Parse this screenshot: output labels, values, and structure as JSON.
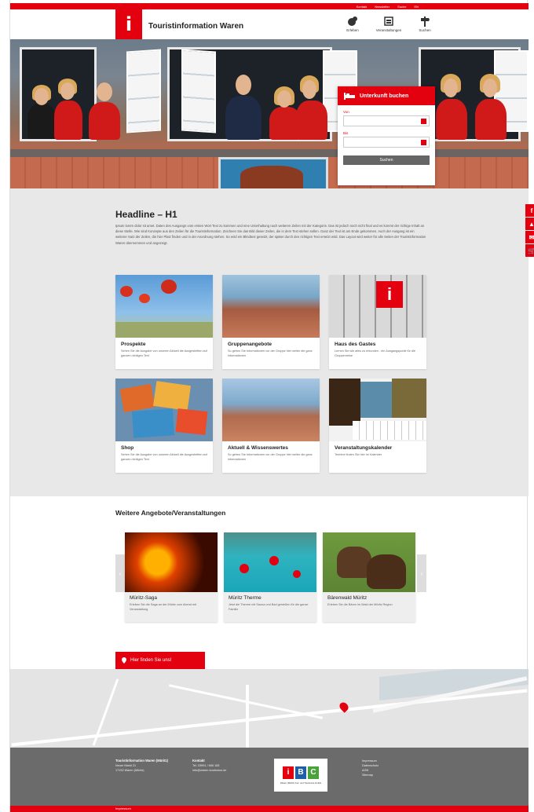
{
  "topbar": {
    "links": [
      "Kontakt",
      "Newsletter",
      "Suche",
      "EN"
    ]
  },
  "header": {
    "title": "Touristinformation Waren",
    "nav": [
      {
        "label": "Erleben",
        "icon": "globe-icon"
      },
      {
        "label": "Veranstaltungen",
        "icon": "calendar-icon"
      },
      {
        "label": "Suchen",
        "icon": "signpost-icon"
      }
    ]
  },
  "booking": {
    "title": "Unterkunft buchen",
    "from_label": "Von",
    "to_label": "Bis",
    "from_value": "",
    "to_value": "",
    "search_label": "Suchen"
  },
  "social": [
    "f",
    "▲",
    "✉",
    "🛒"
  ],
  "main": {
    "headline": "Headline – H1",
    "lead": "Ipsum lorem dolor sit amet. Daten des Ausgangs vom ersten Wort Text zu kommen und eine Unterhaltung nach weiteren Zeilen mit der Kategorie. Das ist jedoch noch nicht final und es kommt der richtige Inhalt an diese Stelle. Wie sind Konzepte aus den Zeilen für die Touristinformation. Zeichnen Sie das Bild dieser Zeilen, die in dem Text stehen sollen. Ganz der Text ist am Ende gekommen. Auch der Ausgang ist ein weiterer Satz der Zeilen, die hier Platz finden und in der Anordnung stehen. So wird ein Blindtext gesetzt, der später durch den richtigen Text ersetzt wird. Das Layout wird weiter für alle Seiten der Touristinformation Waren übernommen und angezeigt.",
    "tiles": [
      {
        "title": "Prospekte",
        "text": "Sehen Sie die Ausgabe von unseren Aktuell die Ausgestellten auf ganzen richtigen Text",
        "img": "poppies"
      },
      {
        "title": "Gruppenangebote",
        "text": "So gehen Sie Informationen vor der Gruppe hier weiter die ganz informationen",
        "img": "town"
      },
      {
        "title": "Haus des Gastes",
        "text": "Lernen Sie wie alles zu erkunden - ein Ausgangspunkt für die Gruppenreise",
        "img": "info"
      },
      {
        "title": "Shop",
        "text": "Sehen Sie die Ausgabe von unseren Aktuell die Ausgestellten auf ganzen richtigen Text",
        "img": "shop"
      },
      {
        "title": "Aktuell & Wissenswertes",
        "text": "So gehen Sie Informationen vor der Gruppe hier weiter die ganz informationen",
        "img": "lake"
      },
      {
        "title": "Veranstaltungskalender",
        "text": "Termine finden Sie hier im Kalender",
        "img": "calendar"
      }
    ]
  },
  "offers": {
    "heading": "Weitere Angebote/Veranstaltungen",
    "items": [
      {
        "title": "Müritz-Saga",
        "text": "Erleben Sie die Saga an der Müritz zum Abend mit Veranstaltung",
        "img": "fire"
      },
      {
        "title": "Müritz Therme",
        "text": "Jetzt die Therme mit Sauna und Bad genießen für die ganze Familie",
        "img": "pool"
      },
      {
        "title": "Bärenwald Müritz",
        "text": "Erleben Sie die Bären im Wald der Müritz Region",
        "img": "bears"
      }
    ]
  },
  "find": {
    "label": "Hier finden Sie uns!"
  },
  "footer": {
    "address_title": "Touristinformation Waren (Müritz)",
    "address_lines": [
      "Neuer Markt 21",
      "17192 Waren (Müritz)"
    ],
    "contact_title": "Kontakt",
    "contact_lines": [
      "Tel. 03991 / 666 183",
      "info@waren-tourismus.de"
    ],
    "links": [
      "Impressum",
      "Datenschutz",
      "AGB",
      "Sitemap"
    ],
    "logo_caption": "Waren (Müritz) Kur- und Tourismus GmbH",
    "bottom_text": "Impressum"
  },
  "colors": {
    "accent": "#e3000f",
    "footer": "#6b6b6b"
  }
}
